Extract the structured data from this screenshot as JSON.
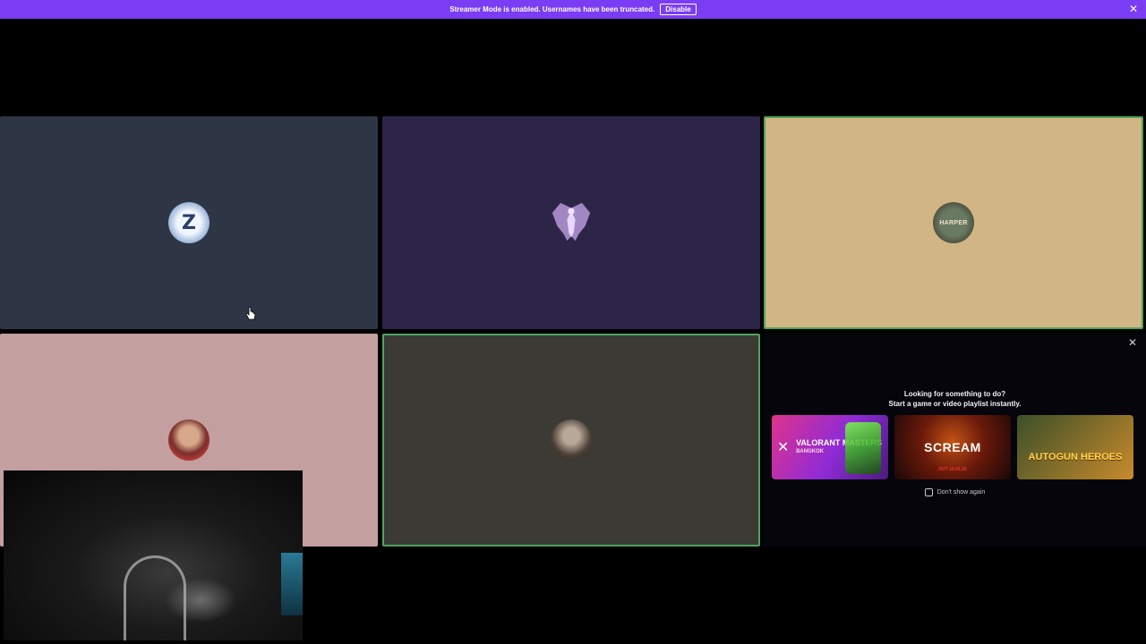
{
  "streamer_bar": {
    "message": "Streamer Mode is enabled. Usernames have been truncated.",
    "disable_label": "Disable",
    "close_glyph": "✕"
  },
  "tiles": [
    {
      "id": "participant-1",
      "background": "#2e3545",
      "avatar_icon": "z-logo-icon",
      "avatar_text": "Z",
      "speaking": false
    },
    {
      "id": "participant-2",
      "background": "#2d2547",
      "avatar_icon": "winged-figure-icon",
      "speaking": false
    },
    {
      "id": "participant-3",
      "background": "#d2b585",
      "avatar_icon": "knight-crest-icon",
      "avatar_text": "HARPER",
      "speaking": true
    },
    {
      "id": "participant-4",
      "background": "#c39f9f",
      "avatar_icon": "helmet-character-icon",
      "speaking": false
    },
    {
      "id": "participant-5",
      "background": "#3b3a35",
      "avatar_icon": "portrait-icon",
      "speaking": true
    }
  ],
  "activity_panel": {
    "close_glyph": "✕",
    "heading_line1": "Looking for something to do?",
    "heading_line2": "Start a game or video playlist instantly.",
    "games": [
      {
        "title": "VALORANT MASTERS",
        "subtitle": "BANGKOK",
        "icon": "valorant-logo-icon"
      },
      {
        "title": "SCREAM",
        "date": "OUT 10.01.25",
        "icon": "scream-logo-icon"
      },
      {
        "title": "AUTOGUN HEROES",
        "icon": "autogun-logo-icon"
      }
    ],
    "dont_show_label": "Don't show again"
  },
  "colors": {
    "streamer_bar": "#7b3df3",
    "speaking_border": "#4ea35c"
  }
}
